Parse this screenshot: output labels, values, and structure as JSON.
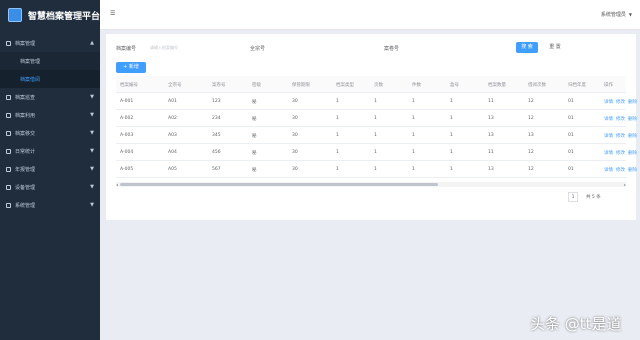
{
  "app": {
    "title": "智慧档案管理平台",
    "user_label": "系统管理员"
  },
  "sidebar": {
    "items": [
      {
        "label": "档案管理",
        "expanded": true
      },
      {
        "label": "档案巡查"
      },
      {
        "label": "档案利用"
      },
      {
        "label": "档案移交"
      },
      {
        "label": "日常统计"
      },
      {
        "label": "年报管理"
      },
      {
        "label": "设备管理"
      },
      {
        "label": "系统管理"
      }
    ],
    "sub_items": [
      {
        "label": "档案管理"
      },
      {
        "label": "档案借阅",
        "active": true
      }
    ]
  },
  "filters": {
    "field1_label": "档案编号",
    "field1_placeholder": "请输入档案编号",
    "field2_label": "全宗号",
    "field3_label": "案卷号",
    "search_label": "搜 索",
    "reset_label": "重 置",
    "add_label": "+ 新增"
  },
  "table": {
    "headers": [
      "档案编号",
      "全宗号",
      "案卷号",
      "密级",
      "保管期限",
      "档案类型",
      "页数",
      "件数",
      "盒号",
      "档案数量",
      "借阅次数",
      "归档年度",
      "操作"
    ],
    "rows": [
      [
        "A-001",
        "A01",
        "123",
        "秘",
        "30",
        "1",
        "1",
        "1",
        "1",
        "11",
        "12",
        "01"
      ],
      [
        "A-002",
        "A02",
        "234",
        "秘",
        "30",
        "1",
        "1",
        "1",
        "1",
        "13",
        "12",
        "01"
      ],
      [
        "A-003",
        "A03",
        "345",
        "秘",
        "30",
        "1",
        "1",
        "1",
        "1",
        "13",
        "13",
        "01"
      ],
      [
        "A-004",
        "A04",
        "456",
        "秘",
        "30",
        "1",
        "1",
        "1",
        "1",
        "11",
        "12",
        "01"
      ],
      [
        "A-005",
        "A05",
        "567",
        "秘",
        "30",
        "1",
        "1",
        "1",
        "1",
        "13",
        "12",
        "01"
      ]
    ],
    "actions": [
      "详情",
      "修改",
      "删除"
    ]
  },
  "pager": {
    "page": "1",
    "total_label": "共 5 条"
  },
  "watermark": "头条 @tt是道"
}
